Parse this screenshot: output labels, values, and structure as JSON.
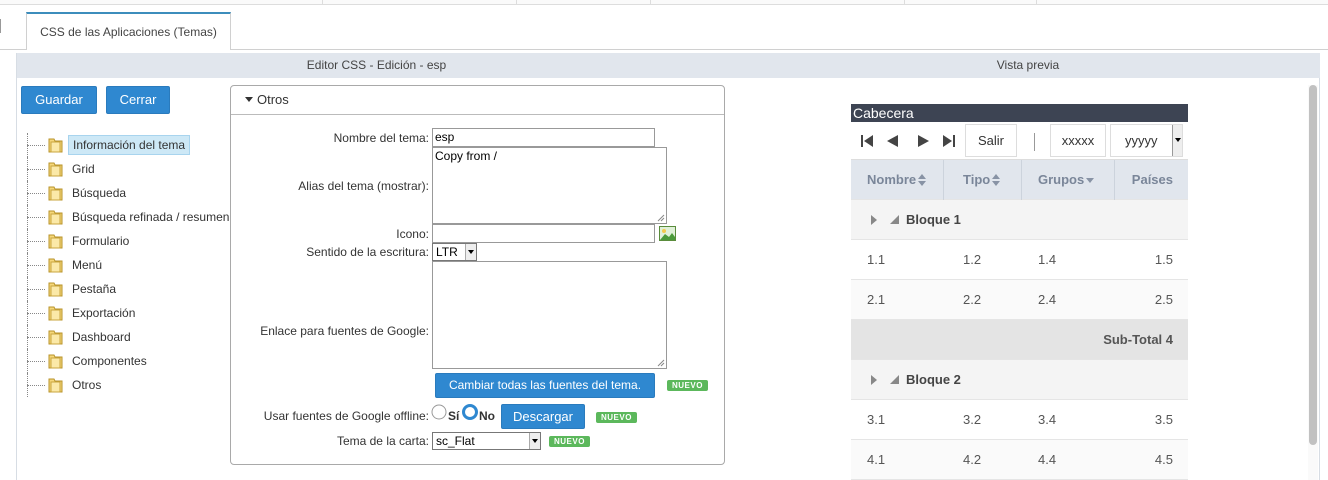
{
  "tab": {
    "label": "CSS de las Aplicaciones (Temas)"
  },
  "editor": {
    "header": "Editor CSS - Edición - esp",
    "save_label": "Guardar",
    "close_label": "Cerrar"
  },
  "preview_header": "Vista previa",
  "tree": {
    "items": [
      {
        "label": "Información del tema",
        "selected": true
      },
      {
        "label": "Grid"
      },
      {
        "label": "Búsqueda"
      },
      {
        "label": "Búsqueda refinada / resumen"
      },
      {
        "label": "Formulario"
      },
      {
        "label": "Menú"
      },
      {
        "label": "Pestaña"
      },
      {
        "label": "Exportación"
      },
      {
        "label": "Dashboard"
      },
      {
        "label": "Componentes"
      },
      {
        "label": "Otros"
      }
    ]
  },
  "panel": {
    "title": "Otros",
    "theme_name_label": "Nombre del tema:",
    "theme_name_value": "esp",
    "alias_label": "Alias del tema (mostrar):",
    "alias_value": "Copy from /",
    "icon_label": "Icono:",
    "icon_value": "",
    "direction_label": "Sentido de la escritura:",
    "direction_value": "LTR",
    "google_fonts_label": "Enlace para fuentes de Google:",
    "google_fonts_value": "",
    "change_fonts_label": "Cambiar todas las fuentes del tema.",
    "new_badge": "NUEVO",
    "offline_label": "Usar fuentes de Google offline:",
    "offline_yes": "Sí",
    "offline_no": "No",
    "offline_selected": "No",
    "download_label": "Descargar",
    "chart_theme_label": "Tema de la carta:",
    "chart_theme_value": "sc_Flat"
  },
  "preview": {
    "caption": "Cabecera",
    "exit_label": "Salir",
    "input1": "xxxxx",
    "input2": "yyyyy",
    "columns": [
      "Nombre",
      "Tipo",
      "Grupos",
      "Países"
    ],
    "groups": [
      {
        "label": "Bloque 1",
        "rows": [
          [
            "1.1",
            "1.2",
            "1.4",
            "1.5"
          ],
          [
            "2.1",
            "2.2",
            "2.4",
            "2.5"
          ]
        ],
        "subtotal": "Sub-Total 4"
      },
      {
        "label": "Bloque 2",
        "rows": [
          [
            "3.1",
            "3.2",
            "3.4",
            "3.5"
          ],
          [
            "4.1",
            "4.2",
            "4.4",
            "4.5"
          ]
        ]
      }
    ]
  },
  "colors": {
    "accent": "#2f88d0",
    "badge": "#5cb85c",
    "header_bg": "#e1e6ed",
    "caption_bg": "#3d4453"
  }
}
